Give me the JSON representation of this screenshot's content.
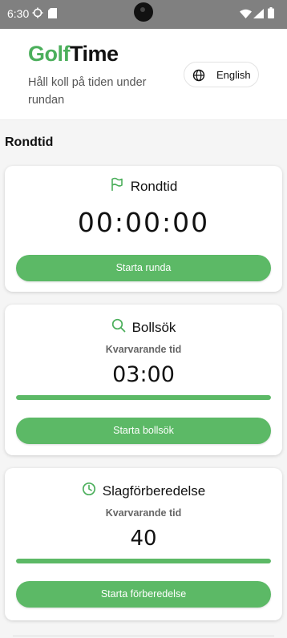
{
  "status_bar": {
    "time": "6:30"
  },
  "header": {
    "logo_part1": "Golf",
    "logo_part2": "Time",
    "tagline": "Håll koll på tiden under rundan",
    "language_label": "English"
  },
  "section_title": "Rondtid",
  "cards": {
    "round": {
      "title": "Rondtid",
      "icon": "flag-icon",
      "timer": "00:00:00",
      "button_label": "Starta runda"
    },
    "ball_search": {
      "title": "Bollsök",
      "icon": "search-icon",
      "sub_label": "Kvarvarande tid",
      "timer": "03:00",
      "progress": 1.0,
      "button_label": "Starta bollsök"
    },
    "shot_prep": {
      "title": "Slagförberedelse",
      "icon": "clock-icon",
      "sub_label": "Kvarvarande tid",
      "timer": "40",
      "progress": 1.0,
      "button_label": "Starta förberedelse"
    }
  },
  "colors": {
    "accent": "#5cb966",
    "logo_green": "#4caf5c",
    "status_bar": "#808080"
  }
}
